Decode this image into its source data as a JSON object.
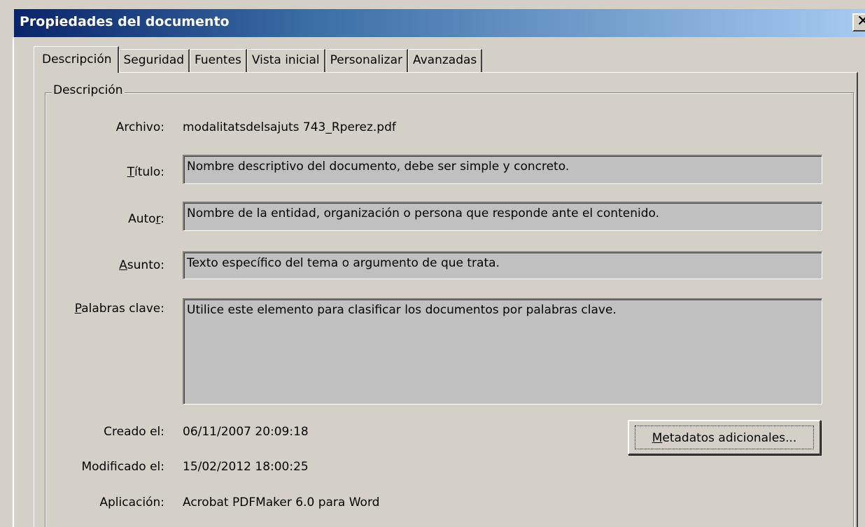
{
  "window": {
    "title": "Propiedades del documento",
    "close_glyph": "✕"
  },
  "tabs": [
    {
      "label": "Descripción",
      "active": true
    },
    {
      "label": "Seguridad"
    },
    {
      "label": "Fuentes"
    },
    {
      "label": "Vista inicial"
    },
    {
      "label": "Personalizar"
    },
    {
      "label": "Avanzadas"
    }
  ],
  "group": {
    "legend": "Descripción"
  },
  "fields": {
    "archivo": {
      "label": "Archivo:",
      "value": "modalitatsdelsajuts 743_Rperez.pdf"
    },
    "titulo": {
      "label_pre": "",
      "label_u": "T",
      "label_post": "ítulo:",
      "value": "Nombre descriptivo del documento, debe ser simple y concreto."
    },
    "autor": {
      "label_pre": "Auto",
      "label_u": "r",
      "label_post": ":",
      "value": "Nombre de la entidad, organización o persona que responde ante el contenido."
    },
    "asunto": {
      "label_pre": "",
      "label_u": "A",
      "label_post": "sunto:",
      "value": "Texto específico del tema o argumento de que trata."
    },
    "palabras": {
      "label_pre": "",
      "label_u": "P",
      "label_post": "alabras clave:",
      "value": "Utilice este elemento para clasificar los documentos por palabras clave."
    },
    "creado": {
      "label": "Creado el:",
      "value": "06/11/2007 20:09:18"
    },
    "modificado": {
      "label": "Modificado el:",
      "value": "15/02/2012 18:00:25"
    },
    "aplicacion": {
      "label": "Aplicación:",
      "value": "Acrobat PDFMaker 6.0 para Word"
    }
  },
  "buttons": {
    "metadatos_u": "M",
    "metadatos_rest": "etadatos adicionales..."
  }
}
